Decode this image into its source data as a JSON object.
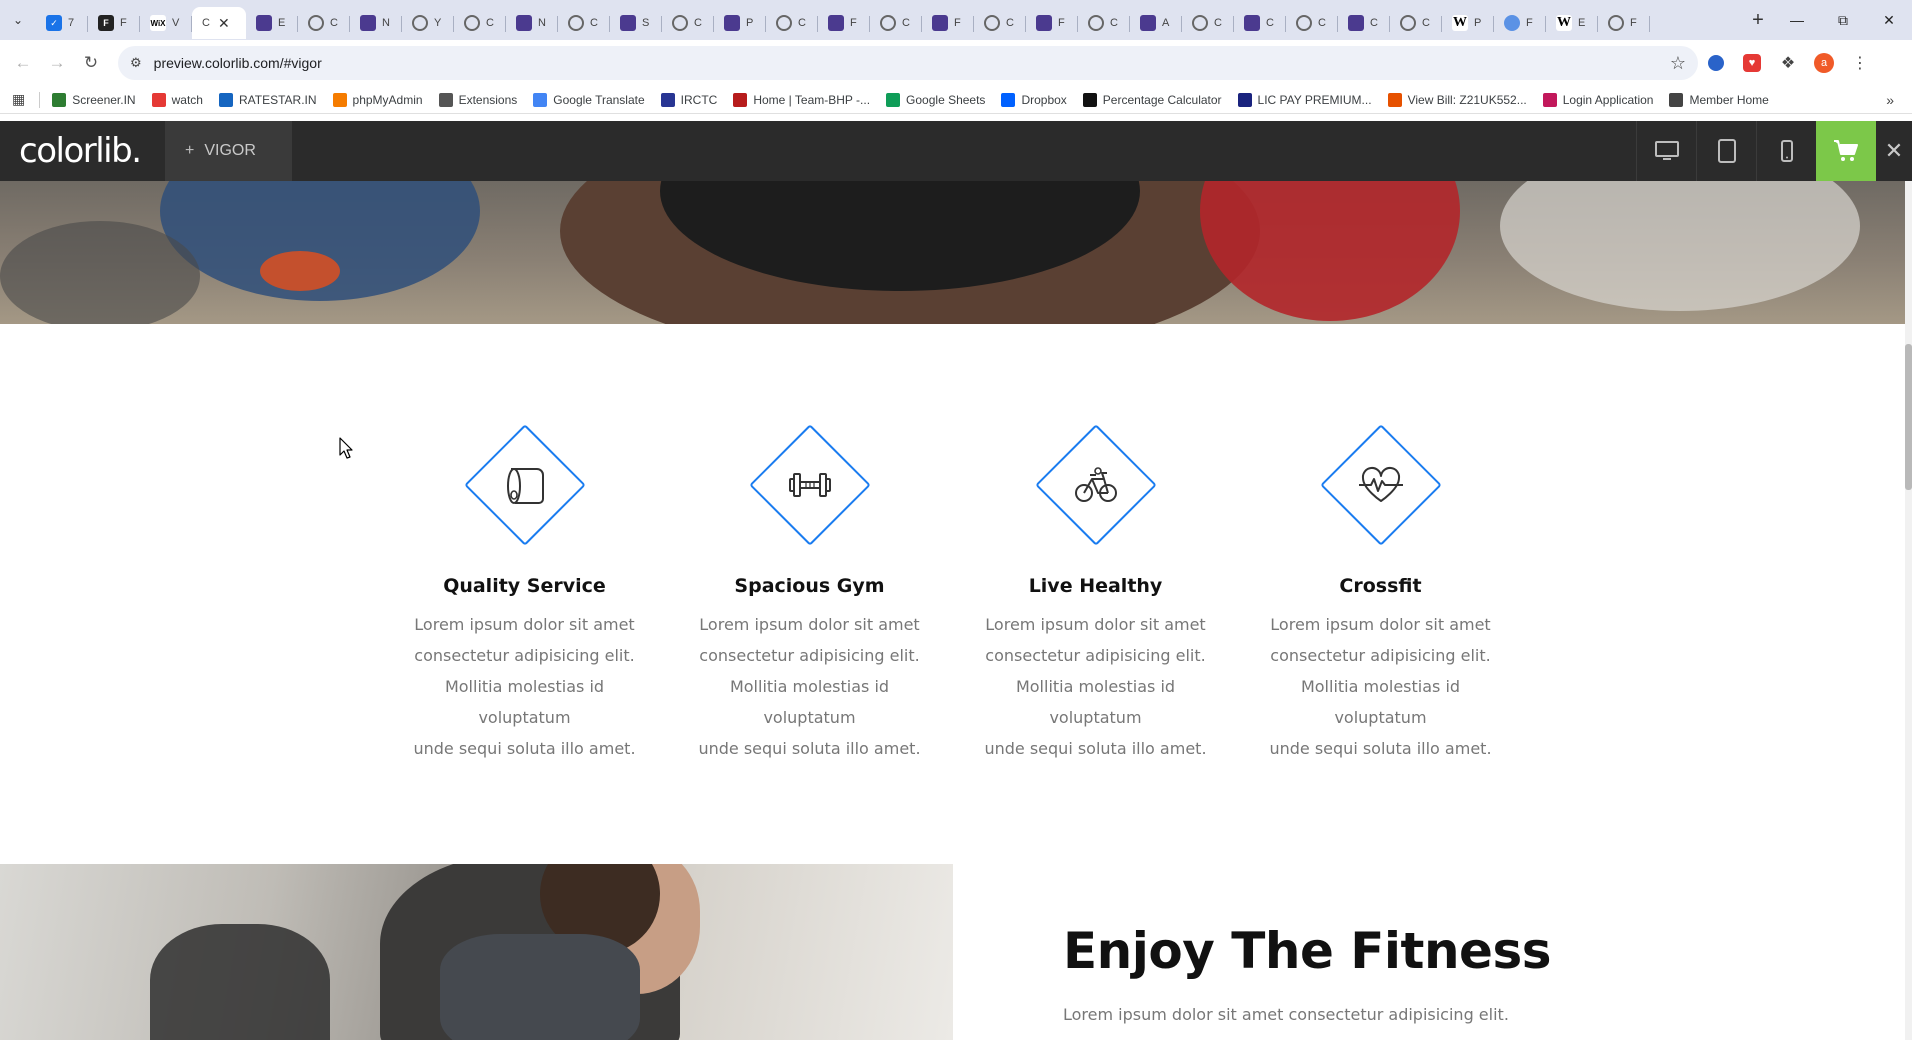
{
  "browser": {
    "tabs": [
      {
        "favicon": "twitter-icon",
        "label": "7",
        "active": false
      },
      {
        "favicon": "framer-icon",
        "label": "F",
        "active": false
      },
      {
        "favicon": "wix-icon",
        "label": "V",
        "active": false
      },
      {
        "favicon": "none",
        "label": "C",
        "active": true
      },
      {
        "favicon": "colorlib-icon",
        "label": "E",
        "active": false
      },
      {
        "favicon": "globe-icon",
        "label": "C",
        "active": false
      },
      {
        "favicon": "colorlib-icon",
        "label": "N",
        "active": false
      },
      {
        "favicon": "globe-icon",
        "label": "Y",
        "active": false
      },
      {
        "favicon": "globe-icon",
        "label": "C",
        "active": false
      },
      {
        "favicon": "colorlib-icon",
        "label": "N",
        "active": false
      },
      {
        "favicon": "globe-icon",
        "label": "C",
        "active": false
      },
      {
        "favicon": "colorlib-icon",
        "label": "S",
        "active": false
      },
      {
        "favicon": "globe-icon",
        "label": "C",
        "active": false
      },
      {
        "favicon": "colorlib-icon",
        "label": "P",
        "active": false
      },
      {
        "favicon": "globe-icon",
        "label": "C",
        "active": false
      },
      {
        "favicon": "colorlib-icon",
        "label": "F",
        "active": false
      },
      {
        "favicon": "globe-icon",
        "label": "C",
        "active": false
      },
      {
        "favicon": "colorlib-icon",
        "label": "F",
        "active": false
      },
      {
        "favicon": "globe-icon",
        "label": "C",
        "active": false
      },
      {
        "favicon": "colorlib-icon",
        "label": "F",
        "active": false
      },
      {
        "favicon": "globe-icon",
        "label": "C",
        "active": false
      },
      {
        "favicon": "colorlib-icon",
        "label": "A",
        "active": false
      },
      {
        "favicon": "globe-icon",
        "label": "C",
        "active": false
      },
      {
        "favicon": "colorlib-icon",
        "label": "C",
        "active": false
      },
      {
        "favicon": "globe-icon",
        "label": "C",
        "active": false
      },
      {
        "favicon": "colorlib-icon",
        "label": "C",
        "active": false
      },
      {
        "favicon": "globe-icon",
        "label": "C",
        "active": false
      },
      {
        "favicon": "wikipedia-icon",
        "label": "P",
        "active": false
      },
      {
        "favicon": "un-icon",
        "label": "F",
        "active": false
      },
      {
        "favicon": "wikipedia-icon",
        "label": "E",
        "active": false
      },
      {
        "favicon": "openai-icon",
        "label": "F",
        "active": false
      }
    ],
    "url": "preview.colorlib.com/#vigor",
    "bookmarks": [
      {
        "label": "Screener.IN",
        "color": "#2e7d32"
      },
      {
        "label": "watch",
        "color": "#e53935"
      },
      {
        "label": "RATESTAR.IN",
        "color": "#1565c0"
      },
      {
        "label": "phpMyAdmin",
        "color": "#f57c00"
      },
      {
        "label": "Extensions",
        "color": "#555555"
      },
      {
        "label": "Google Translate",
        "color": "#4285f4"
      },
      {
        "label": "IRCTC",
        "color": "#283593"
      },
      {
        "label": "Home | Team-BHP -...",
        "color": "#b71c1c"
      },
      {
        "label": "Google Sheets",
        "color": "#0f9d58"
      },
      {
        "label": "Dropbox",
        "color": "#0061ff"
      },
      {
        "label": "Percentage Calculator",
        "color": "#111111"
      },
      {
        "label": "LIC PAY PREMIUM...",
        "color": "#1a237e"
      },
      {
        "label": "View Bill: Z21UK552...",
        "color": "#e65100"
      },
      {
        "label": "Login Application",
        "color": "#c2185b"
      },
      {
        "label": "Member Home",
        "color": "#444444"
      }
    ],
    "profile_initial": "a"
  },
  "preview_bar": {
    "logo": "colorlib.",
    "theme_name": "VIGOR",
    "accent": "#7cc849"
  },
  "features": [
    {
      "icon": "yoga-mat-icon",
      "title": "Quality Service",
      "line1": "Lorem ipsum dolor sit amet",
      "line2": "consectetur adipisicing elit.",
      "line3": "Mollitia molestias id voluptatum",
      "line4": "unde sequi soluta illo amet."
    },
    {
      "icon": "dumbbell-icon",
      "title": "Spacious Gym",
      "line1": "Lorem ipsum dolor sit amet",
      "line2": "consectetur adipisicing elit.",
      "line3": "Mollitia molestias id voluptatum",
      "line4": "unde sequi soluta illo amet."
    },
    {
      "icon": "bicycle-icon",
      "title": "Live Healthy",
      "line1": "Lorem ipsum dolor sit amet",
      "line2": "consectetur adipisicing elit.",
      "line3": "Mollitia molestias id voluptatum",
      "line4": "unde sequi soluta illo amet."
    },
    {
      "icon": "heartbeat-icon",
      "title": "Crossfit",
      "line1": "Lorem ipsum dolor sit amet",
      "line2": "consectetur adipisicing elit.",
      "line3": "Mollitia molestias id voluptatum",
      "line4": "unde sequi soluta illo amet."
    }
  ],
  "fitness": {
    "title": "Enjoy The Fitness",
    "text": "Lorem ipsum dolor sit amet consectetur adipisicing elit."
  },
  "colors": {
    "icon_blue": "#1a7cf0",
    "preview_bar_bg": "#2b2b2b"
  }
}
